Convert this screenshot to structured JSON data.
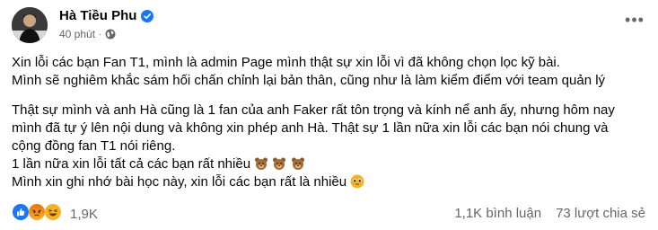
{
  "header": {
    "author_name": "Hà Tiều Phu",
    "time": "40 phút",
    "separator": "·"
  },
  "post": {
    "p1": [
      "Xin lỗi các bạn Fan T1, mình là admin Page mình thật sự xin lỗi vì đã không chọn lọc kỹ bài.",
      "Mình sẽ nghiêm khắc sám hối chấn chỉnh lại bản thân, cũng như là làm kiểm điểm với team quản lý"
    ],
    "p2": [
      "Thật sự mình và anh Hà cũng là 1 fan của anh Faker rất tôn trọng và kính nể anh ấy, nhưng hôm nay",
      "mình đã tự ý lên nội  dung và không xin phép anh Hà. Thật sự 1 lần nữa xin lỗi các bạn nói chung và",
      "cộng đồng fan T1 nói riêng.",
      "1 lần nữa xin lỗi tất cả các bạn rất nhiều",
      "Mình xin ghi nhớ bài học này, xin lỗi các bạn rất là nhiều"
    ],
    "emoji": {
      "bear_emoji": "bear-face-emoji",
      "sad_emoji": "pleading-face-emoji"
    }
  },
  "footer": {
    "reaction_count": "1,9K",
    "comments": "1,1K bình luận",
    "shares": "73 lượt chia sẻ",
    "reaction_icons": [
      "like-icon",
      "angry-icon",
      "haha-icon"
    ]
  },
  "colors": {
    "like": "#1877f2",
    "angry": "#e9710f",
    "haha": "#f7b125",
    "muted": "#65676b",
    "verified": "#1877f2"
  }
}
